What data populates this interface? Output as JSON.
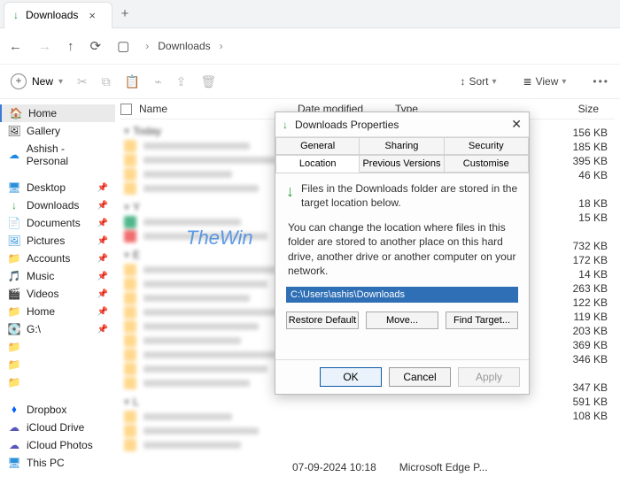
{
  "tab": {
    "label": "Downloads",
    "close": "×",
    "newtab": "+"
  },
  "nav": {
    "crumb1": "Downloads"
  },
  "toolbar": {
    "new": "New",
    "sort": "Sort",
    "view": "View"
  },
  "columns": {
    "name": "Name",
    "date": "Date modified",
    "type": "Type",
    "size": "Size"
  },
  "groups": {
    "today": "Today",
    "y": "Y",
    "e": "E",
    "l": "L"
  },
  "sidebar": {
    "home": "Home",
    "gallery": "Gallery",
    "ashish": "Ashish - Personal",
    "desktop": "Desktop",
    "downloads": "Downloads",
    "documents": "Documents",
    "pictures": "Pictures",
    "accounts": "Accounts",
    "music": "Music",
    "videos": "Videos",
    "home2": "Home",
    "g": "G:\\",
    "dropbox": "Dropbox",
    "icloudd": "iCloud Drive",
    "icloudp": "iCloud Photos",
    "thispc": "This PC"
  },
  "sizes": [
    "156 KB",
    "185 KB",
    "395 KB",
    "46 KB",
    "",
    "18 KB",
    "15 KB",
    "",
    "732 KB",
    "172 KB",
    "14 KB",
    "263 KB",
    "122 KB",
    "119 KB",
    "203 KB",
    "369 KB",
    "346 KB",
    "",
    "347 KB",
    "591 KB",
    "108 KB"
  ],
  "bottom": {
    "date": "07-09-2024 10:18",
    "type": "Microsoft Edge P..."
  },
  "watermark": "TheWin",
  "dlg": {
    "title": "Downloads Properties",
    "tabs": {
      "general": "General",
      "sharing": "Sharing",
      "security": "Security",
      "location": "Location",
      "prev": "Previous Versions",
      "custom": "Customise"
    },
    "line1": "Files in the Downloads folder are stored in the target location below.",
    "line2": "You can change the location where files in this folder are stored to another place on this hard drive, another drive or another computer on your network.",
    "path": "C:\\Users\\ashis\\Downloads",
    "restore": "Restore Default",
    "move": "Move...",
    "find": "Find Target...",
    "ok": "OK",
    "cancel": "Cancel",
    "apply": "Apply"
  }
}
